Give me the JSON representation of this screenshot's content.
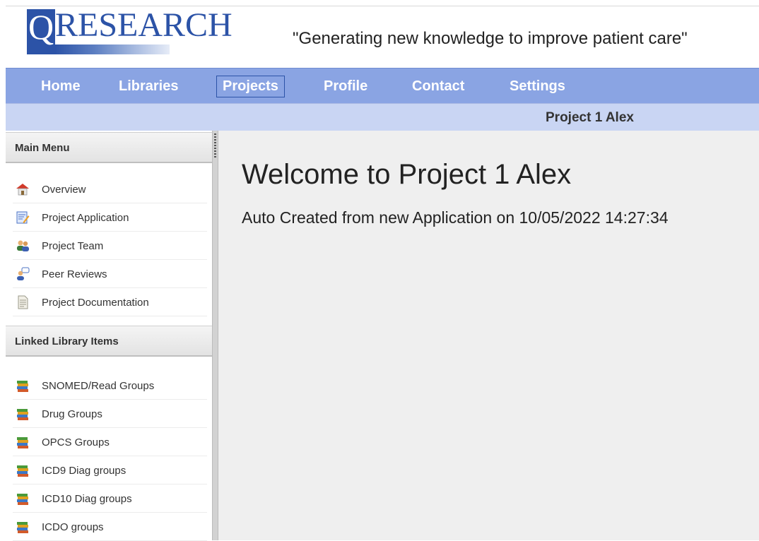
{
  "header": {
    "logo_letter": "Q",
    "logo_word": "RESEARCH",
    "tagline": "\"Generating new knowledge to improve patient care\""
  },
  "nav": {
    "items": [
      "Home",
      "Libraries",
      "Projects",
      "Profile",
      "Contact",
      "Settings"
    ],
    "active": "Projects"
  },
  "subbar": {
    "project_title": "Project 1 Alex"
  },
  "sidebar": {
    "main_menu_title": "Main Menu",
    "main_menu": [
      {
        "label": "Overview",
        "icon": "house-icon"
      },
      {
        "label": "Project Application",
        "icon": "application-form-icon"
      },
      {
        "label": "Project Team",
        "icon": "team-icon"
      },
      {
        "label": "Peer Reviews",
        "icon": "reviewer-icon"
      },
      {
        "label": "Project Documentation",
        "icon": "document-icon"
      }
    ],
    "linked_title": "Linked Library Items",
    "linked_items": [
      {
        "label": "SNOMED/Read Groups",
        "icon": "books-icon"
      },
      {
        "label": "Drug Groups",
        "icon": "books-icon"
      },
      {
        "label": "OPCS Groups",
        "icon": "books-icon"
      },
      {
        "label": "ICD9 Diag groups",
        "icon": "books-icon"
      },
      {
        "label": "ICD10 Diag groups",
        "icon": "books-icon"
      },
      {
        "label": "ICDO groups",
        "icon": "books-icon"
      }
    ]
  },
  "main": {
    "welcome": "Welcome to Project 1 Alex",
    "subtitle": "Auto Created from new Application on 10/05/2022 14:27:34"
  },
  "colors": {
    "brand_blue": "#2c53a7",
    "nav_bg": "#8aa4e3",
    "subbar_bg": "#c9d5f3",
    "content_bg": "#efefef"
  }
}
